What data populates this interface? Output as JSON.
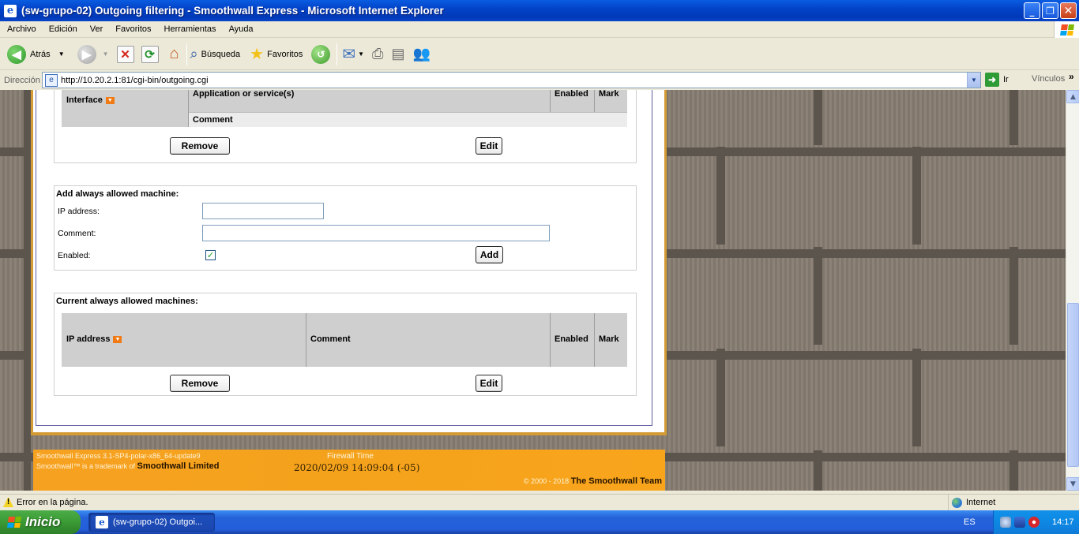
{
  "window": {
    "title": "(sw-grupo-02) Outgoing filtering - Smoothwall Express - Microsoft Internet Explorer"
  },
  "menu": [
    "Archivo",
    "Edición",
    "Ver",
    "Favoritos",
    "Herramientas",
    "Ayuda"
  ],
  "toolbar": {
    "back_label": "Atrás",
    "search_label": "Búsqueda",
    "favorites_label": "Favoritos"
  },
  "addressbar": {
    "label": "Dirección",
    "url": "http://10.20.2.1:81/cgi-bin/outgoing.cgi",
    "go_label": "Ir",
    "links_label": "Vínculos"
  },
  "rules_table": {
    "col_interface": "Interface",
    "col_application": "Application or service(s)",
    "col_enabled": "Enabled",
    "col_mark": "Mark",
    "col_comment": "Comment",
    "remove_label": "Remove",
    "edit_label": "Edit"
  },
  "add_machine": {
    "title": "Add always allowed machine:",
    "ip_label": "IP address:",
    "ip_value": "",
    "comment_label": "Comment:",
    "comment_value": "",
    "enabled_label": "Enabled:",
    "enabled_checked": true,
    "add_label": "Add"
  },
  "current_machines": {
    "title": "Current always allowed machines:",
    "col_ip": "IP address",
    "col_comment": "Comment",
    "col_enabled": "Enabled",
    "col_mark": "Mark",
    "remove_label": "Remove",
    "edit_label": "Edit"
  },
  "footer": {
    "version": "Smoothwall Express 3.1-SP4-polar-x86_64-update9",
    "trademark_prefix": "Smoothwall™ is a trademark of ",
    "trademark_owner": "Smoothwall Limited",
    "firewall_time_label": "Firewall Time",
    "firewall_time": "2020/02/09 14:09:04 (-05)",
    "copyright_prefix": "© 2000 - 2018 ",
    "team": "The Smoothwall Team"
  },
  "statusbar": {
    "message": "Error en la página.",
    "zone": "Internet"
  },
  "taskbar": {
    "start_label": "Inicio",
    "task_label": "(sw-grupo-02) Outgoi...",
    "language": "ES",
    "clock": "14:17"
  },
  "colors": {
    "accent_orange": "#f7a121",
    "xp_blue": "#0243c8",
    "start_green": "#3a9a34"
  }
}
